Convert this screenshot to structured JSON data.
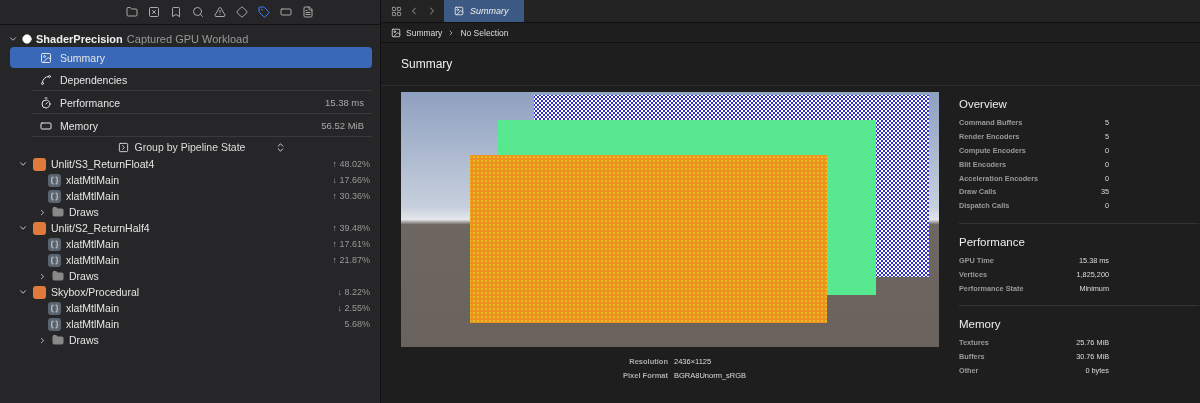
{
  "navigator": {
    "root": {
      "name": "ShaderPrecision",
      "subtitle": "Captured GPU Workload",
      "expanded": true
    },
    "items": [
      {
        "kind": "summary",
        "label": "Summary",
        "selected": true
      },
      {
        "kind": "dependencies",
        "label": "Dependencies",
        "selected": false
      },
      {
        "kind": "performance",
        "label": "Performance",
        "value": "15.38 ms",
        "selected": false
      },
      {
        "kind": "memory",
        "label": "Memory",
        "value": "56.52 MiB",
        "selected": false
      }
    ],
    "group_by": "Group by Pipeline State",
    "pipelines": [
      {
        "name": "Unlit/S3_ReturnFloat4",
        "delta": "↑ 48.02%",
        "expanded": true,
        "children": [
          {
            "kind": "function",
            "name": "xlatMtlMain",
            "delta": "↓ 17.66%"
          },
          {
            "kind": "function",
            "name": "xlatMtlMain",
            "delta": "↑ 30.36%"
          },
          {
            "kind": "folder",
            "name": "Draws",
            "expanded": false
          }
        ]
      },
      {
        "name": "Unlit/S2_ReturnHalf4",
        "delta": "↑ 39.48%",
        "expanded": true,
        "children": [
          {
            "kind": "function",
            "name": "xlatMtlMain",
            "delta": "↑ 17.61%"
          },
          {
            "kind": "function",
            "name": "xlatMtlMain",
            "delta": "↑ 21.87%"
          },
          {
            "kind": "folder",
            "name": "Draws",
            "expanded": false
          }
        ]
      },
      {
        "name": "Skybox/Procedural",
        "delta": "↓ 8.22%",
        "expanded": true,
        "children": [
          {
            "kind": "function",
            "name": "xlatMtlMain",
            "delta": "↓ 2.55%"
          },
          {
            "kind": "function",
            "name": "xlatMtlMain",
            "delta": "5.68%"
          },
          {
            "kind": "folder",
            "name": "Draws",
            "expanded": false
          }
        ]
      }
    ]
  },
  "editor": {
    "tabs": [
      {
        "label": "Summary",
        "selected": true
      }
    ],
    "breadcrumb": [
      "Summary",
      "No Selection"
    ],
    "title": "Summary",
    "attachment_info": [
      {
        "label": "Resolution",
        "value": "2436×1125"
      },
      {
        "label": "Pixel Format",
        "value": "BGRA8Unorm_sRGB"
      }
    ],
    "sections": [
      {
        "title": "Overview",
        "rows": [
          {
            "label": "Command Buffers",
            "value": "5"
          },
          {
            "label": "Render Encoders",
            "value": "5"
          },
          {
            "label": "Compute Encoders",
            "value": "0"
          },
          {
            "label": "Blit Encoders",
            "value": "0"
          },
          {
            "label": "Acceleration Encoders",
            "value": "0"
          },
          {
            "label": "Draw Calls",
            "value": "35"
          },
          {
            "label": "Dispatch Calls",
            "value": "0"
          }
        ]
      },
      {
        "title": "Performance",
        "rows": [
          {
            "label": "GPU Time",
            "value": "15.38 ms"
          },
          {
            "label": "Vertices",
            "value": "1,825,200"
          },
          {
            "label": "Performance State",
            "value": "Minimum"
          }
        ]
      },
      {
        "title": "Memory",
        "rows": [
          {
            "label": "Textures",
            "value": "25.76 MiB"
          },
          {
            "label": "Buffers",
            "value": "30.76 MiB"
          },
          {
            "label": "Other",
            "value": "0 bytes"
          }
        ]
      }
    ]
  }
}
